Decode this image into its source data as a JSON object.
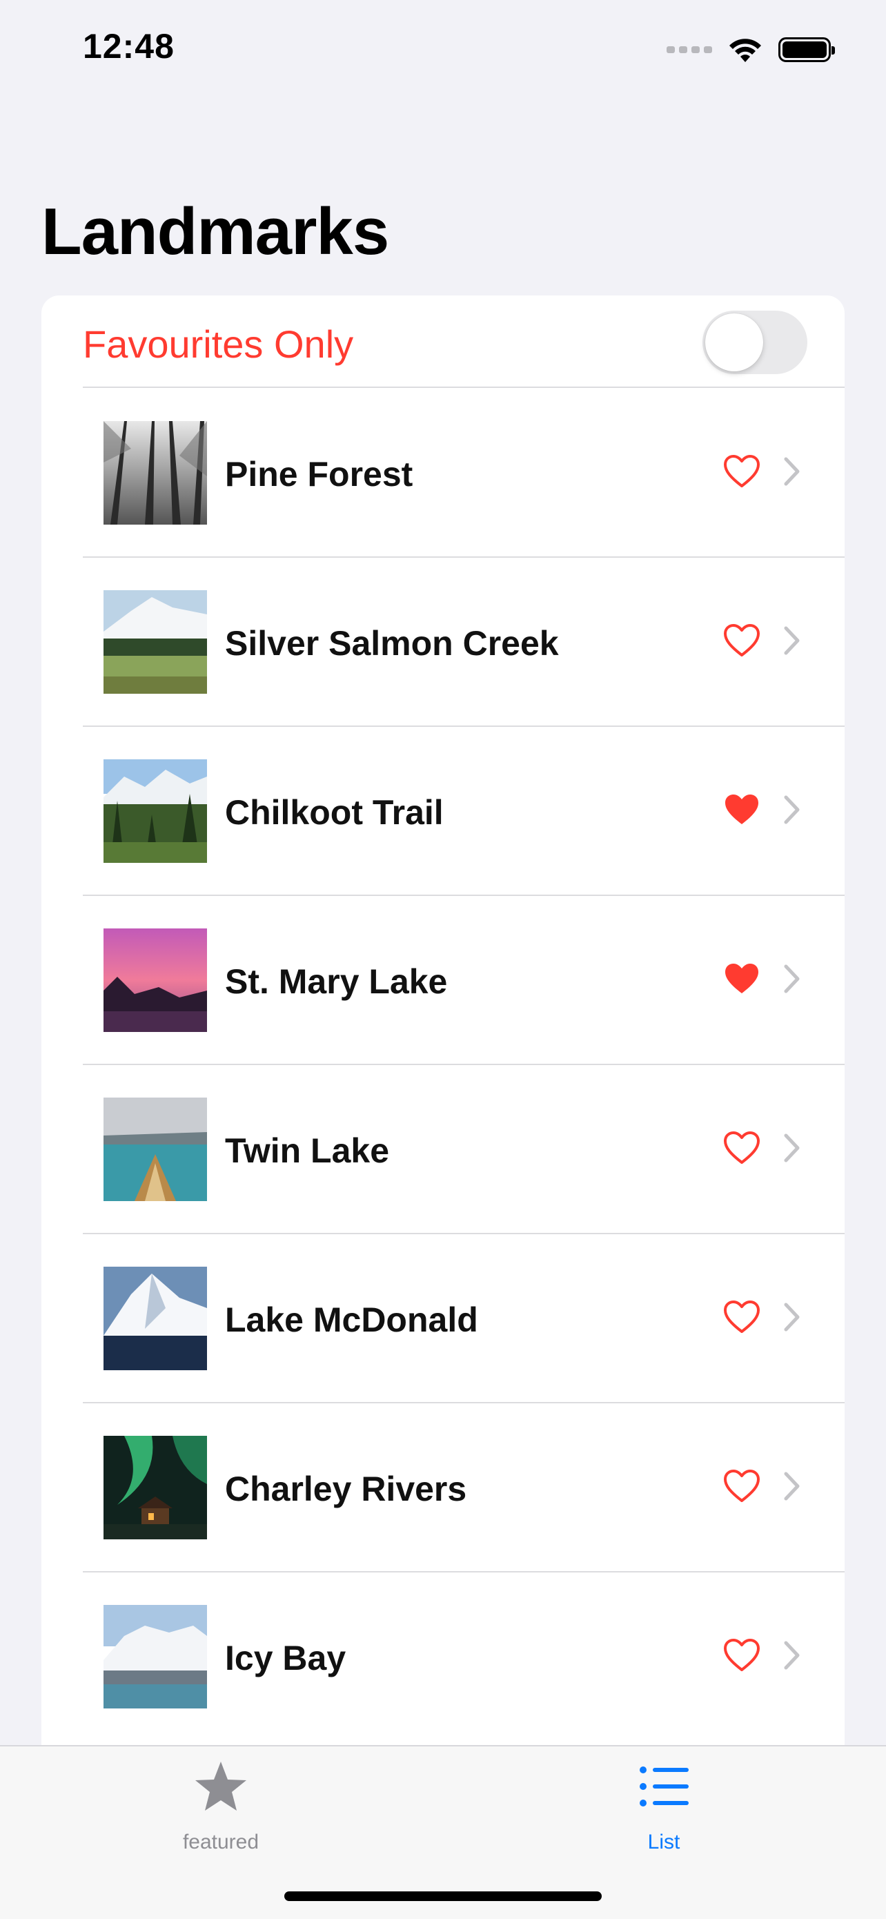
{
  "status_bar": {
    "time": "12:48"
  },
  "title": "Landmarks",
  "favourites_toggle": {
    "label": "Favourites Only",
    "on": false
  },
  "landmarks": [
    {
      "name": "Pine Forest",
      "favourite": false,
      "image": "pine-forest"
    },
    {
      "name": "Silver Salmon Creek",
      "favourite": false,
      "image": "silver-salmon-creek"
    },
    {
      "name": "Chilkoot Trail",
      "favourite": true,
      "image": "chilkoot-trail"
    },
    {
      "name": "St. Mary Lake",
      "favourite": true,
      "image": "st-mary-lake"
    },
    {
      "name": "Twin Lake",
      "favourite": false,
      "image": "twin-lake"
    },
    {
      "name": "Lake McDonald",
      "favourite": false,
      "image": "lake-mcdonald"
    },
    {
      "name": "Charley Rivers",
      "favourite": false,
      "image": "charley-rivers"
    },
    {
      "name": "Icy Bay",
      "favourite": false,
      "image": "icy-bay"
    }
  ],
  "tabs": [
    {
      "label": "featured",
      "icon": "star-icon",
      "selected": false
    },
    {
      "label": "List",
      "icon": "list-icon",
      "selected": true
    }
  ],
  "colors": {
    "accent_red": "#ff3b30",
    "tab_selected": "#0a7aff",
    "tab_unselected": "#8e8e93",
    "chevron": "#c4c4c7"
  }
}
